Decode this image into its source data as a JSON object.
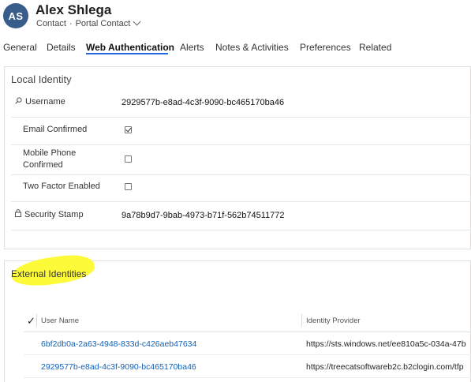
{
  "record": {
    "initials": "AS",
    "name": "Alex Shlega",
    "entity": "Contact",
    "form": "Portal Contact"
  },
  "tabs": [
    {
      "label": "General"
    },
    {
      "label": "Details"
    },
    {
      "label": "Web Authentication"
    },
    {
      "label": "Alerts"
    },
    {
      "label": "Notes & Activities"
    },
    {
      "label": "Preferences"
    },
    {
      "label": "Related"
    }
  ],
  "active_tab": "Web Authentication",
  "local_identity": {
    "title": "Local Identity",
    "username_label": "Username",
    "username_value": "2929577b-e8ad-4c3f-9090-bc465170ba46",
    "email_confirmed_label": "Email Confirmed",
    "email_confirmed": true,
    "mobile_phone_confirmed_label": "Mobile Phone Confirmed",
    "mobile_phone_confirmed": false,
    "two_factor_label": "Two Factor Enabled",
    "two_factor_enabled": false,
    "security_stamp_label": "Security Stamp",
    "security_stamp_value": "9a78b9d7-9bab-4973-b71f-562b74511772"
  },
  "external_identities": {
    "title": "External Identities",
    "highlight_color": "#fdfb39",
    "columns": {
      "user_name": "User Name",
      "identity_provider": "Identity Provider"
    },
    "rows": [
      {
        "user_name": "6bf2db0a-2a63-4948-833d-c426aeb47634",
        "identity_provider": "https://sts.windows.net/ee810a5c-034a-47b"
      },
      {
        "user_name": "2929577b-e8ad-4c3f-9090-bc465170ba46",
        "identity_provider": "https://treecatsoftwareb2c.b2clogin.com/tfp"
      }
    ]
  },
  "colors": {
    "avatar": "#385d8a",
    "tab_underline": "#2266e3",
    "link": "#1160b7"
  }
}
